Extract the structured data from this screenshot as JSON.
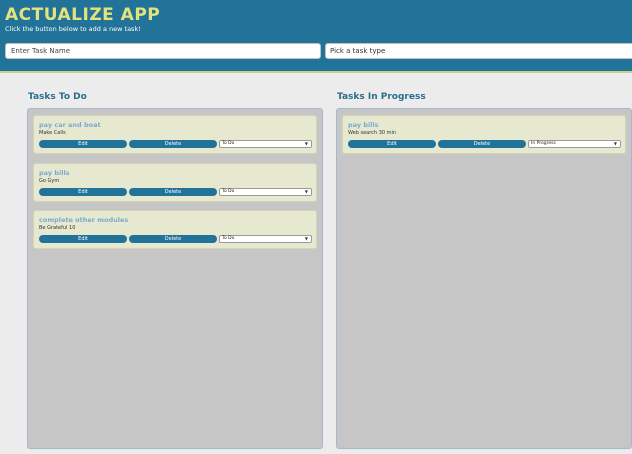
{
  "header": {
    "title": "ACTUALIZE APP",
    "subtitle": "Click the button below to add a new task!",
    "task_name_placeholder": "Enter Task Name",
    "task_type_placeholder": "Pick a task type"
  },
  "columns": {
    "todo": {
      "title": "Tasks To Do",
      "cards": [
        {
          "title": "pay car and boat",
          "desc": "Make Calls",
          "edit": "Edit",
          "delete": "Delete",
          "status": "To Do"
        },
        {
          "title": "pay bills",
          "desc": "Go Gym",
          "edit": "Edit",
          "delete": "Delete",
          "status": "To Do"
        },
        {
          "title": "complete other modules",
          "desc": "Be Grateful 10",
          "edit": "Edit",
          "delete": "Delete",
          "status": "To Do"
        }
      ]
    },
    "in_progress": {
      "title": "Tasks In Progress",
      "cards": [
        {
          "title": "pay bills",
          "desc": "Web search 30 min",
          "edit": "Edit",
          "delete": "Delete",
          "status": "In Progress"
        }
      ]
    }
  },
  "icons": {
    "dropdown": "chevron-down-icon"
  },
  "colors": {
    "header_bg": "#227399",
    "title": "#e4e27a",
    "button": "#227399",
    "card_bg": "#e6e9d0",
    "column_bg": "#c6c6c6"
  }
}
